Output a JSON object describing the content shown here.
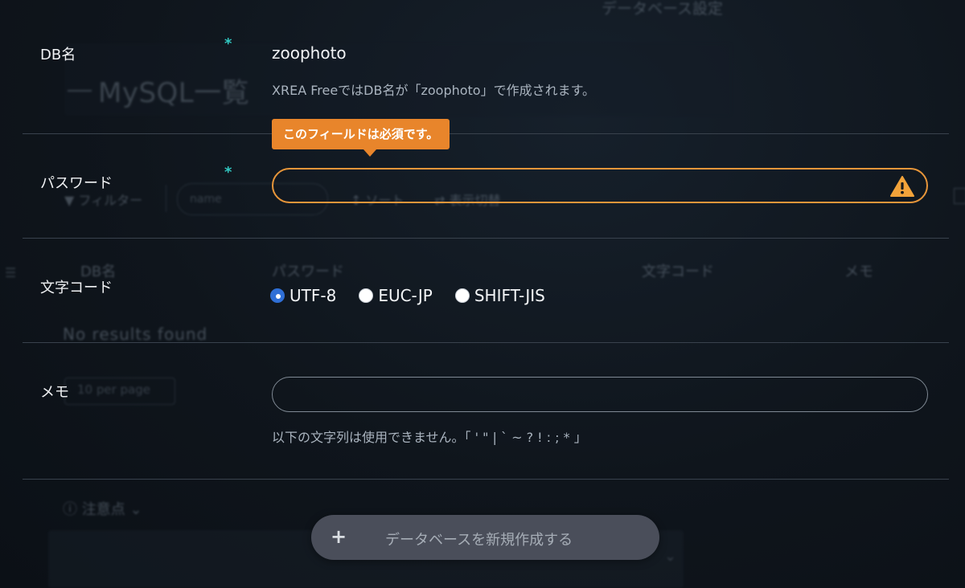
{
  "background": {
    "header_title": "データベース設定",
    "page_title": "MySQL一覧",
    "filter_label": "▼ フィルター",
    "name_placeholder": "name",
    "sort_label": "↕ ソート",
    "view_label": "⇄ 表示切替",
    "columns": [
      "DB名",
      "パスワード",
      "文字コード",
      "メモ"
    ],
    "no_results": "No results found",
    "per_page": "10 per page",
    "caution_label": "注意点"
  },
  "form": {
    "db_name": {
      "label": "DB名",
      "required_mark": "*",
      "value": "zoophoto",
      "helper": "XREA FreeではDB名が「zoophoto」で作成されます。"
    },
    "password": {
      "label": "パスワード",
      "required_mark": "*",
      "value": "",
      "tooltip": "このフィールドは必須です。",
      "warning_icon": "warning-triangle-icon"
    },
    "charset": {
      "label": "文字コード",
      "options": [
        "UTF-8",
        "EUC-JP",
        "SHIFT-JIS"
      ],
      "selected": "UTF-8"
    },
    "memo": {
      "label": "メモ",
      "value": "",
      "helper": "以下の文字列は使用できません。「 ' \" | ` ~ ? ! : ; * 」"
    }
  },
  "submit": {
    "icon": "plus-icon",
    "label": "データベースを新規作成する"
  },
  "colors": {
    "required": "#31c7c1",
    "warning": "#e8963a",
    "tooltip": "#e8852b",
    "radio_checked": "#2f6fd6",
    "button_bg": "#4a4e5a"
  }
}
